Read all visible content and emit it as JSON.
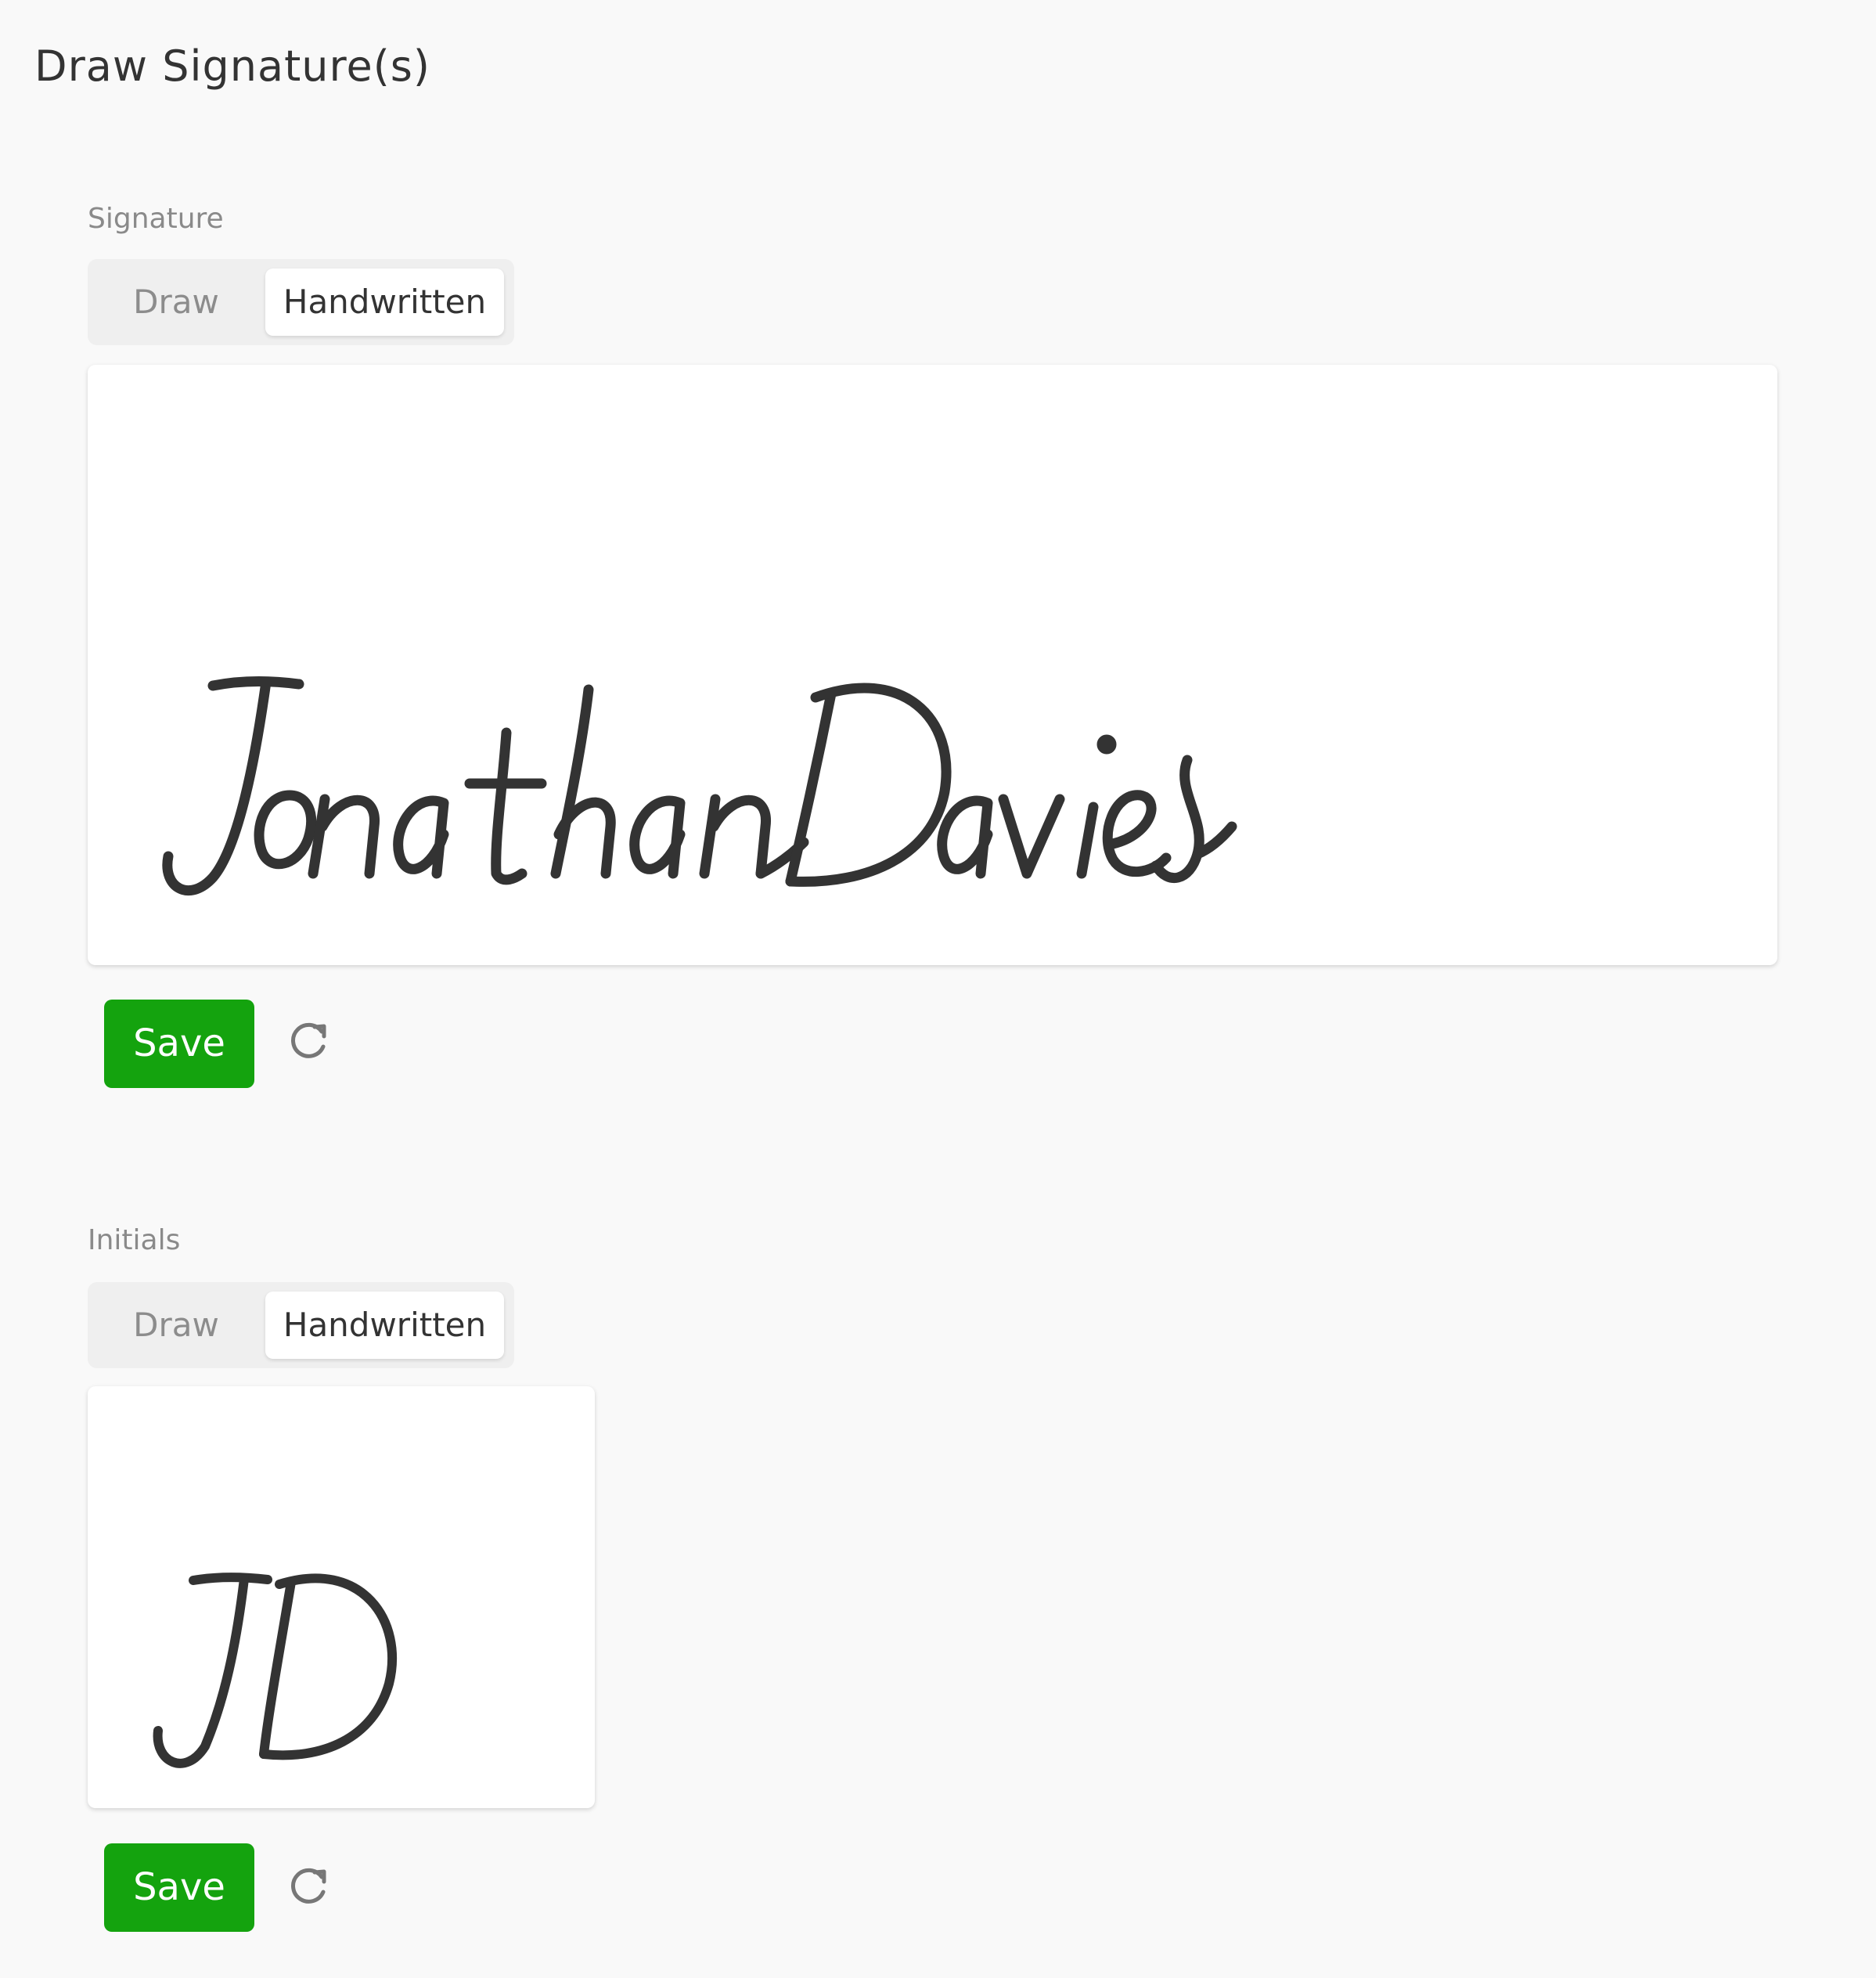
{
  "page": {
    "title": "Draw Signature(s)"
  },
  "signature": {
    "label": "Signature",
    "tabs": [
      "Draw",
      "Handwritten"
    ],
    "selected_tab": "Handwritten",
    "handwritten_text": "Jonathan Davies",
    "save_label": "Save",
    "reset_icon": "refresh-icon"
  },
  "initials": {
    "label": "Initials",
    "tabs": [
      "Draw",
      "Handwritten"
    ],
    "selected_tab": "Handwritten",
    "handwritten_text": "JD",
    "save_label": "Save",
    "reset_icon": "refresh-icon"
  },
  "colors": {
    "save_button": "#14a30e",
    "ink": "#333333",
    "background": "#f9f9f9"
  }
}
